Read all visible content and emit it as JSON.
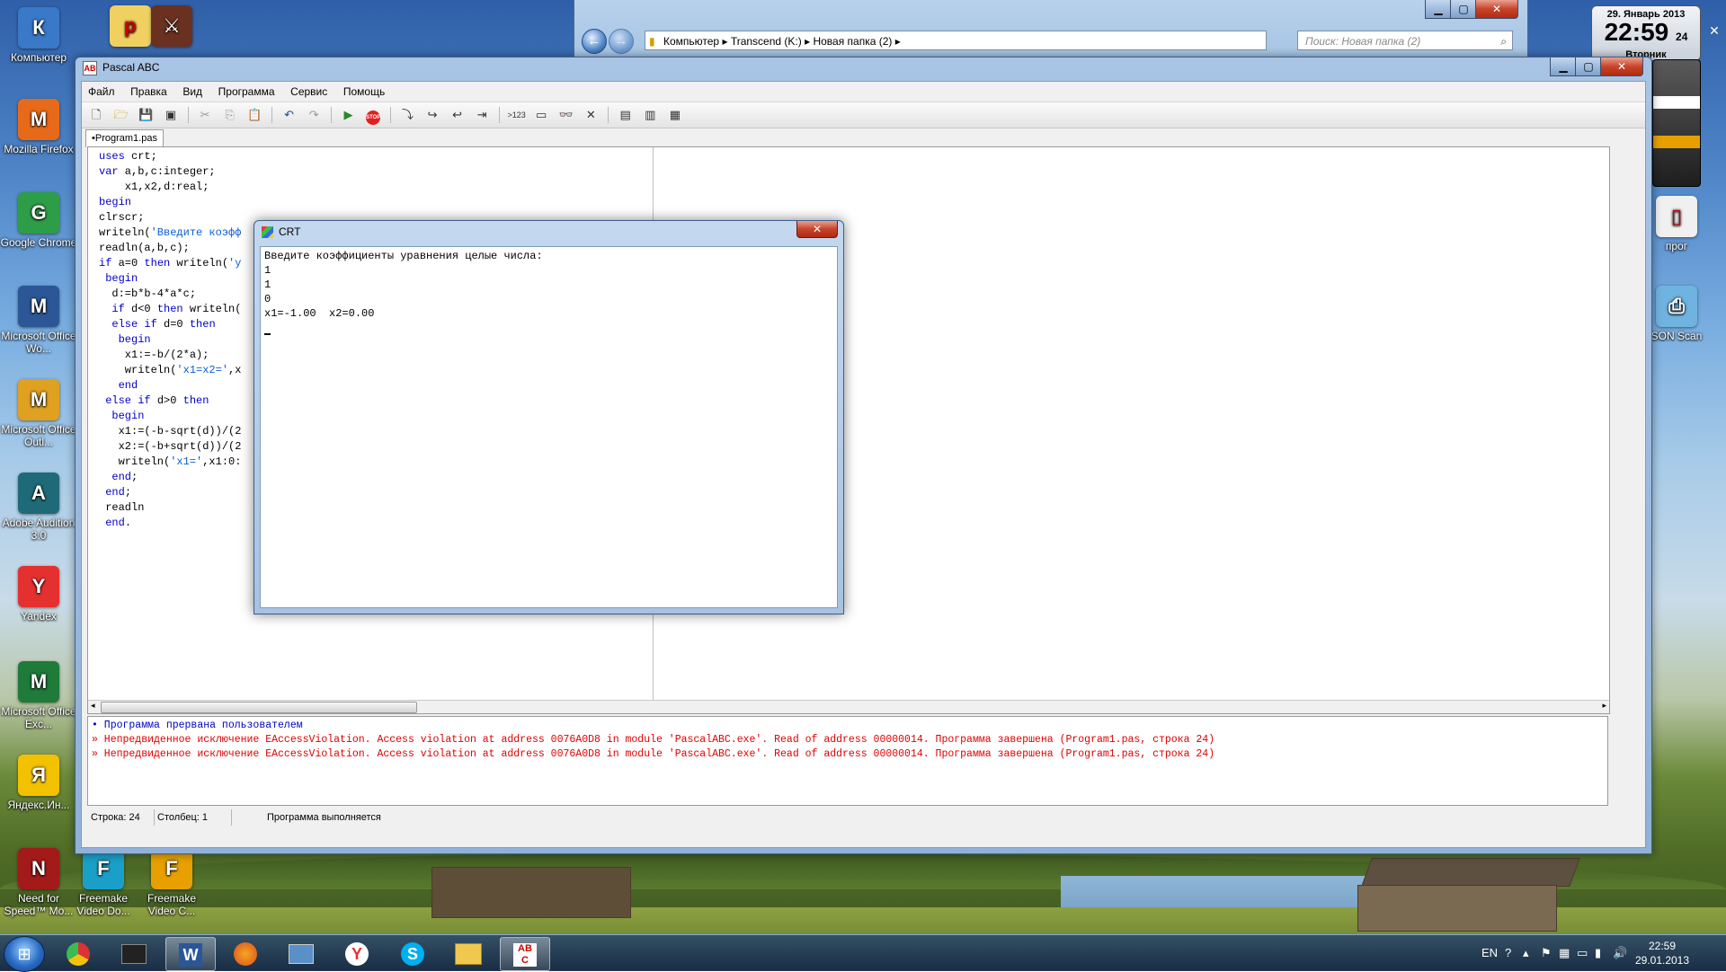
{
  "desktop": {
    "icons": [
      {
        "label": "Компьютер",
        "color": "#3a78c8"
      },
      {
        "label": "Mozilla Firefox",
        "color": "#e66a1a"
      },
      {
        "label": "Google Chrome",
        "color": "#2e9d48"
      },
      {
        "label": "Microsoft Office Wo...",
        "color": "#2b5797"
      },
      {
        "label": "Microsoft Office Outl...",
        "color": "#e0a020"
      },
      {
        "label": "Adobe Audition 3.0",
        "color": "#1f6a78"
      },
      {
        "label": "Yandex",
        "color": "#e53030"
      },
      {
        "label": "Microsoft Office Exc...",
        "color": "#1e7b3a"
      },
      {
        "label": "Яндекс.Ин...",
        "color": "#f2c200"
      },
      {
        "label": "Need for Speed™ Mo...",
        "color": "#a31a1a"
      },
      {
        "label": "Freemake Video Do...",
        "color": "#1aa0c8"
      },
      {
        "label": "Freemake Video C...",
        "color": "#e8a000"
      }
    ],
    "right_icons": [
      {
        "label": "прог"
      },
      {
        "label": "SON Scan"
      }
    ]
  },
  "explorer": {
    "address_parts": [
      "Компьютер",
      "Transcend (K:)",
      "Новая папка (2)"
    ],
    "search_placeholder": "Поиск: Новая папка (2)"
  },
  "gadgets": {
    "date": "29. Январь 2013",
    "time": "22:59",
    "seconds": "24",
    "weekday": "Вторник"
  },
  "pascal": {
    "title": "Pascal ABC",
    "menu": [
      "Файл",
      "Правка",
      "Вид",
      "Программа",
      "Сервис",
      "Помощь"
    ],
    "tab": "•Program1.pas",
    "code_lines": [
      "uses crt;",
      "var a,b,c:integer;",
      "    x1,x2,d:real;",
      "begin",
      "clrscr;",
      "writeln('Введите коэфф",
      "readln(a,b,c);",
      "if a=0 then writeln('у",
      " begin",
      "  d:=b*b-4*a*c;",
      "  if d<0 then writeln(",
      "  else if d=0 then",
      "   begin",
      "    x1:=-b/(2*a);",
      "    writeln('x1=x2=',x",
      "   end",
      " else if d>0 then",
      "  begin",
      "   x1:=(-b-sqrt(d))/(2",
      "   x2:=(-b+sqrt(d))/(2",
      "   writeln('x1=',x1:0:",
      "  end;",
      " end;",
      " readln",
      " end."
    ],
    "output_lines": [
      {
        "marker": "•",
        "text": "Программа прервана пользователем",
        "kind": "blue"
      },
      {
        "marker": "»",
        "text": "Непредвиденное исключение EAccessViolation. Access violation at address 0076A0D8 in module 'PascalABC.exe'. Read of address 00000014. Программа завершена (Program1.pas, строка 24)",
        "kind": "red"
      },
      {
        "marker": "»",
        "text": "Непредвиденное исключение EAccessViolation. Access violation at address 0076A0D8 in module 'PascalABC.exe'. Read of address 00000014. Программа завершена (Program1.pas, строка 24)",
        "kind": "red"
      }
    ],
    "status": {
      "line": "Строка: 24",
      "column": "Столбец: 1",
      "state": "Программа выполняется"
    }
  },
  "crt": {
    "title": "CRT",
    "lines": [
      "Введите коэффициенты уравнения целые числа:",
      "1",
      "1",
      "0",
      "x1=-1.00  x2=0.00"
    ]
  },
  "taskbar": {
    "lang": "EN",
    "time": "22:59",
    "date": "29.01.2013"
  }
}
